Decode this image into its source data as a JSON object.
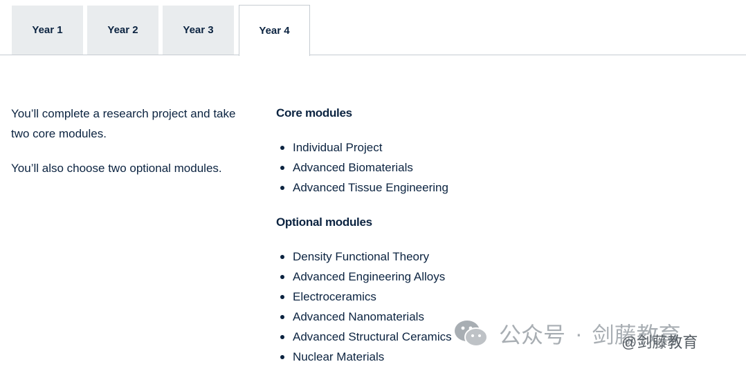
{
  "tabs": [
    {
      "label": "Year 1"
    },
    {
      "label": "Year 2"
    },
    {
      "label": "Year 3"
    },
    {
      "label": "Year 4"
    }
  ],
  "active_tab": "Year 4",
  "intro": {
    "paragraph_1": "You’ll complete a research project and take two core modules.",
    "paragraph_2": "You’ll also choose two optional modules."
  },
  "core": {
    "heading": "Core modules",
    "items": [
      "Individual Project",
      "Advanced Biomaterials",
      "Advanced Tissue Engineering"
    ]
  },
  "optional": {
    "heading": "Optional modules",
    "items": [
      "Density Functional Theory",
      "Advanced Engineering Alloys",
      "Electroceramics",
      "Advanced Nanomaterials",
      "Advanced Structural Ceramics",
      "Nuclear Materials"
    ]
  },
  "watermark": {
    "icon": "wechat-icon",
    "text_1": "公众号",
    "separator": "·",
    "text_2": "剑藤教育",
    "sub_text": "@剑藤教育"
  },
  "colors": {
    "text": "#0b2340",
    "tab_inactive_bg": "#e9ecee",
    "border": "#c6ccd2"
  }
}
